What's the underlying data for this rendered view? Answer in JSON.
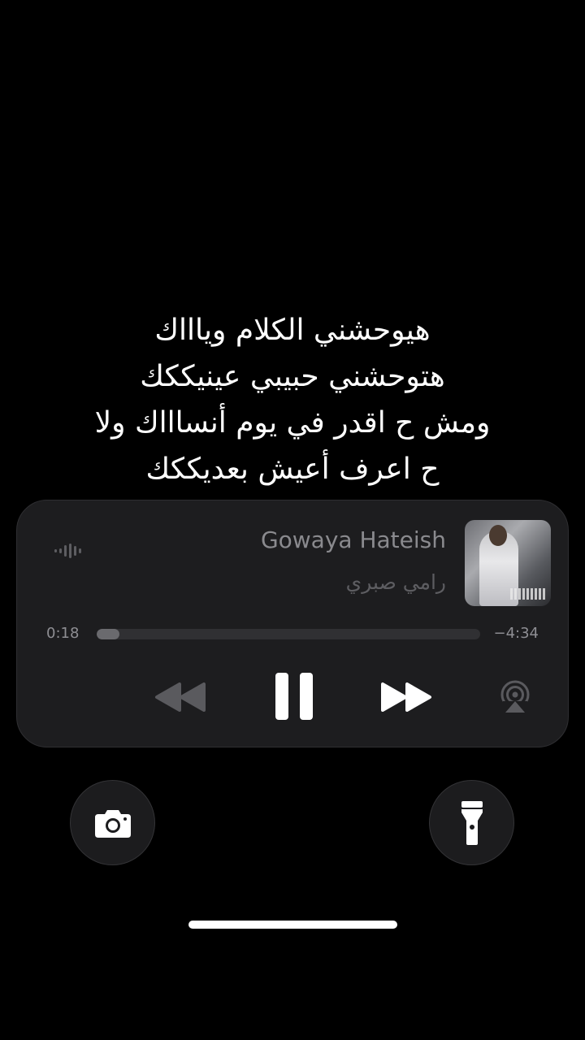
{
  "lyrics": [
    "هيوحشني الكلام وياااك",
    "هتوحشني حبيبي عينيككك",
    "ومش ح اقدر في يوم أنساااك ولا",
    "ح اعرف أعيش بعديككك"
  ],
  "now_playing": {
    "title": "Gowaya Hateish",
    "artist": "رامي صبري",
    "elapsed": "0:18",
    "remaining": "−4:34",
    "progress": 0.06,
    "state": "playing"
  },
  "controls": {
    "rewind_icon": "backward-icon",
    "pause_icon": "pause-icon",
    "forward_icon": "forward-icon",
    "airplay_icon": "airplay-audio-icon",
    "waveform_icon": "audio-waveform-icon"
  },
  "quick_actions": {
    "left_icon": "camera-icon",
    "right_icon": "flashlight-icon"
  },
  "colors": {
    "background": "#000000",
    "player_background": "#1d1d1f",
    "title_text": "#8a8a8e",
    "artist_text": "#5d5d61",
    "progress_fill": "#6a6a6e",
    "progress_track": "#303033"
  }
}
